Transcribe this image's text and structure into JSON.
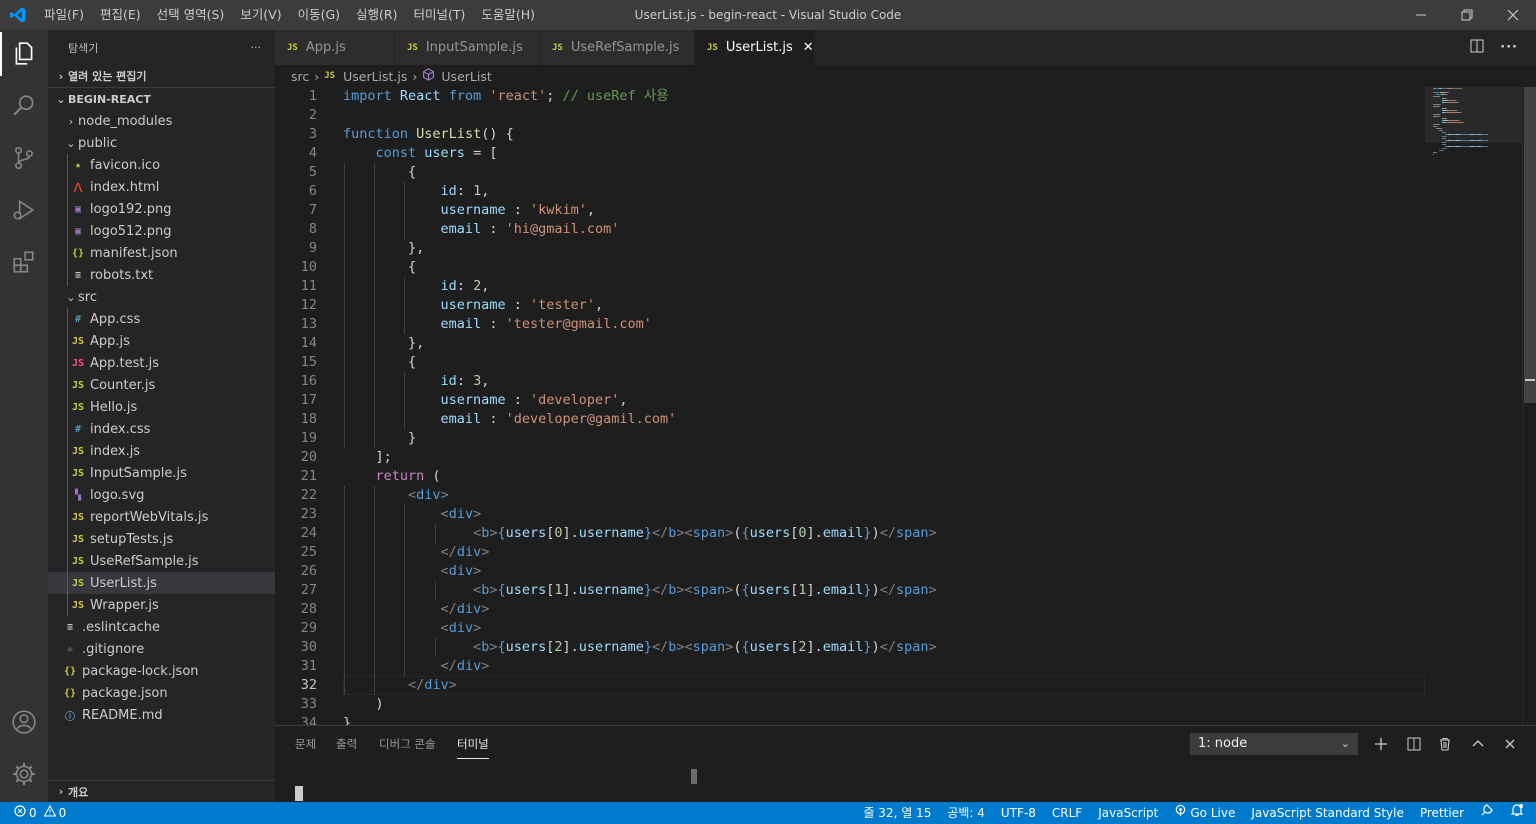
{
  "titlebar": {
    "menus": [
      "파일(F)",
      "편집(E)",
      "선택 영역(S)",
      "보기(V)",
      "이동(G)",
      "실행(R)",
      "터미널(T)",
      "도움말(H)"
    ],
    "title": "UserList.js - begin-react - Visual Studio Code"
  },
  "sidebar": {
    "title": "탐색기",
    "more": "···",
    "open_editors": "열려 있는 편집기",
    "project": "BEGIN-REACT",
    "tree": [
      {
        "label": "node_modules",
        "type": "folder",
        "expanded": false,
        "depth": 0
      },
      {
        "label": "public",
        "type": "folder",
        "expanded": true,
        "depth": 0
      },
      {
        "label": "favicon.ico",
        "type": "star",
        "depth": 1
      },
      {
        "label": "index.html",
        "type": "html",
        "depth": 1
      },
      {
        "label": "logo192.png",
        "type": "image",
        "depth": 1
      },
      {
        "label": "logo512.png",
        "type": "image",
        "depth": 1
      },
      {
        "label": "manifest.json",
        "type": "json",
        "depth": 1
      },
      {
        "label": "robots.txt",
        "type": "text",
        "depth": 1
      },
      {
        "label": "src",
        "type": "folder",
        "expanded": true,
        "depth": 0
      },
      {
        "label": "App.css",
        "type": "css",
        "depth": 1
      },
      {
        "label": "App.js",
        "type": "js",
        "depth": 1
      },
      {
        "label": "App.test.js",
        "type": "test",
        "depth": 1
      },
      {
        "label": "Counter.js",
        "type": "js",
        "depth": 1
      },
      {
        "label": "Hello.js",
        "type": "js",
        "depth": 1
      },
      {
        "label": "index.css",
        "type": "css",
        "depth": 1
      },
      {
        "label": "index.js",
        "type": "js",
        "depth": 1
      },
      {
        "label": "InputSample.js",
        "type": "js",
        "depth": 1
      },
      {
        "label": "logo.svg",
        "type": "svg",
        "depth": 1
      },
      {
        "label": "reportWebVitals.js",
        "type": "js",
        "depth": 1
      },
      {
        "label": "setupTests.js",
        "type": "js",
        "depth": 1
      },
      {
        "label": "UseRefSample.js",
        "type": "js",
        "depth": 1
      },
      {
        "label": "UserList.js",
        "type": "js",
        "depth": 1,
        "selected": true
      },
      {
        "label": "Wrapper.js",
        "type": "js",
        "depth": 1
      },
      {
        "label": ".eslintcache",
        "type": "text",
        "depth": 0
      },
      {
        "label": ".gitignore",
        "type": "git",
        "depth": 0
      },
      {
        "label": "package-lock.json",
        "type": "json",
        "depth": 0
      },
      {
        "label": "package.json",
        "type": "json",
        "depth": 0
      },
      {
        "label": "README.md",
        "type": "info",
        "depth": 0
      }
    ],
    "outline": "개요"
  },
  "tabs": [
    {
      "label": "App.js",
      "active": false
    },
    {
      "label": "InputSample.js",
      "active": false
    },
    {
      "label": "UseRefSample.js",
      "active": false
    },
    {
      "label": "UserList.js",
      "active": true
    }
  ],
  "breadcrumb": {
    "folder": "src",
    "file": "UserList.js",
    "symbol": "UserList"
  },
  "editor": {
    "current_line": 32,
    "lines": [
      [
        [
          "import",
          "kw"
        ],
        [
          " ",
          ""
        ],
        [
          "React",
          "var"
        ],
        [
          " ",
          ""
        ],
        [
          "from",
          "kw"
        ],
        [
          " ",
          ""
        ],
        [
          "'react'",
          "str"
        ],
        [
          "; ",
          ""
        ],
        [
          "// useRef 사용",
          "com"
        ]
      ],
      [],
      [
        [
          "function",
          "kw"
        ],
        [
          " ",
          ""
        ],
        [
          "UserList",
          "fn"
        ],
        [
          "() {",
          ""
        ]
      ],
      [
        [
          "    ",
          ""
        ],
        [
          "const",
          "kw"
        ],
        [
          " ",
          ""
        ],
        [
          "users",
          "var"
        ],
        [
          " = [",
          ""
        ]
      ],
      [
        [
          "        {",
          ""
        ]
      ],
      [
        [
          "            ",
          ""
        ],
        [
          "id",
          "var"
        ],
        [
          ": ",
          ""
        ],
        [
          "1",
          "num"
        ],
        [
          ",",
          ""
        ]
      ],
      [
        [
          "            ",
          ""
        ],
        [
          "username",
          "var"
        ],
        [
          " : ",
          ""
        ],
        [
          "'kwkim'",
          "str"
        ],
        [
          ",",
          ""
        ]
      ],
      [
        [
          "            ",
          ""
        ],
        [
          "email",
          "var"
        ],
        [
          " : ",
          ""
        ],
        [
          "'hi@gmail.com'",
          "str"
        ]
      ],
      [
        [
          "        },",
          ""
        ]
      ],
      [
        [
          "        {",
          ""
        ]
      ],
      [
        [
          "            ",
          ""
        ],
        [
          "id",
          "var"
        ],
        [
          ": ",
          ""
        ],
        [
          "2",
          "num"
        ],
        [
          ",",
          ""
        ]
      ],
      [
        [
          "            ",
          ""
        ],
        [
          "username",
          "var"
        ],
        [
          " : ",
          ""
        ],
        [
          "'tester'",
          "str"
        ],
        [
          ",",
          ""
        ]
      ],
      [
        [
          "            ",
          ""
        ],
        [
          "email",
          "var"
        ],
        [
          " : ",
          ""
        ],
        [
          "'tester@gmail.com'",
          "str"
        ]
      ],
      [
        [
          "        },",
          ""
        ]
      ],
      [
        [
          "        {",
          ""
        ]
      ],
      [
        [
          "            ",
          ""
        ],
        [
          "id",
          "var"
        ],
        [
          ": ",
          ""
        ],
        [
          "3",
          "num"
        ],
        [
          ",",
          ""
        ]
      ],
      [
        [
          "            ",
          ""
        ],
        [
          "username",
          "var"
        ],
        [
          " : ",
          ""
        ],
        [
          "'developer'",
          "str"
        ],
        [
          ",",
          ""
        ]
      ],
      [
        [
          "            ",
          ""
        ],
        [
          "email",
          "var"
        ],
        [
          " : ",
          ""
        ],
        [
          "'developer@gamil.com'",
          "str"
        ]
      ],
      [
        [
          "        }",
          ""
        ]
      ],
      [
        [
          "    ];",
          ""
        ]
      ],
      [
        [
          "    ",
          ""
        ],
        [
          "return",
          "ctl"
        ],
        [
          " (",
          ""
        ]
      ],
      [
        [
          "        ",
          ""
        ],
        [
          "<",
          "tag"
        ],
        [
          "div",
          "tn"
        ],
        [
          ">",
          "tag"
        ]
      ],
      [
        [
          "            ",
          ""
        ],
        [
          "<",
          "tag"
        ],
        [
          "div",
          "tn"
        ],
        [
          ">",
          "tag"
        ]
      ],
      [
        [
          "                ",
          ""
        ],
        [
          "<",
          "tag"
        ],
        [
          "b",
          "tn"
        ],
        [
          ">",
          "tag"
        ],
        [
          "{",
          "tn"
        ],
        [
          "users",
          "var"
        ],
        [
          "[",
          ""
        ],
        [
          "0",
          "num"
        ],
        [
          "].",
          ""
        ],
        [
          "username",
          "var"
        ],
        [
          "}",
          "tn"
        ],
        [
          "</",
          "tag"
        ],
        [
          "b",
          "tn"
        ],
        [
          ">",
          "tag"
        ],
        [
          "<",
          "tag"
        ],
        [
          "span",
          "tn"
        ],
        [
          ">",
          "tag"
        ],
        [
          "(",
          ""
        ],
        [
          "{",
          "tn"
        ],
        [
          "users",
          "var"
        ],
        [
          "[",
          ""
        ],
        [
          "0",
          "num"
        ],
        [
          "].",
          ""
        ],
        [
          "email",
          "var"
        ],
        [
          "}",
          "tn"
        ],
        [
          ")",
          ""
        ],
        [
          "</",
          "tag"
        ],
        [
          "span",
          "tn"
        ],
        [
          ">",
          "tag"
        ]
      ],
      [
        [
          "            ",
          ""
        ],
        [
          "</",
          "tag"
        ],
        [
          "div",
          "tn"
        ],
        [
          ">",
          "tag"
        ]
      ],
      [
        [
          "            ",
          ""
        ],
        [
          "<",
          "tag"
        ],
        [
          "div",
          "tn"
        ],
        [
          ">",
          "tag"
        ]
      ],
      [
        [
          "                ",
          ""
        ],
        [
          "<",
          "tag"
        ],
        [
          "b",
          "tn"
        ],
        [
          ">",
          "tag"
        ],
        [
          "{",
          "tn"
        ],
        [
          "users",
          "var"
        ],
        [
          "[",
          ""
        ],
        [
          "1",
          "num"
        ],
        [
          "].",
          ""
        ],
        [
          "username",
          "var"
        ],
        [
          "}",
          "tn"
        ],
        [
          "</",
          "tag"
        ],
        [
          "b",
          "tn"
        ],
        [
          ">",
          "tag"
        ],
        [
          "<",
          "tag"
        ],
        [
          "span",
          "tn"
        ],
        [
          ">",
          "tag"
        ],
        [
          "(",
          ""
        ],
        [
          "{",
          "tn"
        ],
        [
          "users",
          "var"
        ],
        [
          "[",
          ""
        ],
        [
          "1",
          "num"
        ],
        [
          "].",
          ""
        ],
        [
          "email",
          "var"
        ],
        [
          "}",
          "tn"
        ],
        [
          ")",
          ""
        ],
        [
          "</",
          "tag"
        ],
        [
          "span",
          "tn"
        ],
        [
          ">",
          "tag"
        ]
      ],
      [
        [
          "            ",
          ""
        ],
        [
          "</",
          "tag"
        ],
        [
          "div",
          "tn"
        ],
        [
          ">",
          "tag"
        ]
      ],
      [
        [
          "            ",
          ""
        ],
        [
          "<",
          "tag"
        ],
        [
          "div",
          "tn"
        ],
        [
          ">",
          "tag"
        ]
      ],
      [
        [
          "                ",
          ""
        ],
        [
          "<",
          "tag"
        ],
        [
          "b",
          "tn"
        ],
        [
          ">",
          "tag"
        ],
        [
          "{",
          "tn"
        ],
        [
          "users",
          "var"
        ],
        [
          "[",
          ""
        ],
        [
          "2",
          "num"
        ],
        [
          "].",
          ""
        ],
        [
          "username",
          "var"
        ],
        [
          "}",
          "tn"
        ],
        [
          "</",
          "tag"
        ],
        [
          "b",
          "tn"
        ],
        [
          ">",
          "tag"
        ],
        [
          "<",
          "tag"
        ],
        [
          "span",
          "tn"
        ],
        [
          ">",
          "tag"
        ],
        [
          "(",
          ""
        ],
        [
          "{",
          "tn"
        ],
        [
          "users",
          "var"
        ],
        [
          "[",
          ""
        ],
        [
          "2",
          "num"
        ],
        [
          "].",
          ""
        ],
        [
          "email",
          "var"
        ],
        [
          "}",
          "tn"
        ],
        [
          ")",
          ""
        ],
        [
          "</",
          "tag"
        ],
        [
          "span",
          "tn"
        ],
        [
          ">",
          "tag"
        ]
      ],
      [
        [
          "            ",
          ""
        ],
        [
          "</",
          "tag"
        ],
        [
          "div",
          "tn"
        ],
        [
          ">",
          "tag"
        ]
      ],
      [
        [
          "        ",
          ""
        ],
        [
          "</",
          "tag"
        ],
        [
          "div",
          "tn"
        ],
        [
          ">",
          "tag"
        ]
      ],
      [
        [
          "    )",
          ""
        ]
      ],
      [
        [
          "}",
          ""
        ]
      ]
    ]
  },
  "panel": {
    "tabs": [
      "문제",
      "출력",
      "디버그 콘솔",
      "터미널"
    ],
    "active_tab": "터미널",
    "terminal_select": "1: node"
  },
  "statusbar": {
    "errors": "0",
    "warnings": "0",
    "position": "줄 32, 열 15",
    "indent": "공백: 4",
    "encoding": "UTF-8",
    "eol": "CRLF",
    "language": "JavaScript",
    "golive": "Go Live",
    "linter": "JavaScript Standard Style",
    "formatter": "Prettier"
  },
  "colors": {
    "statusbar": "#007acc",
    "accent": "#0078d4",
    "js_icon": "#cbcb41"
  }
}
